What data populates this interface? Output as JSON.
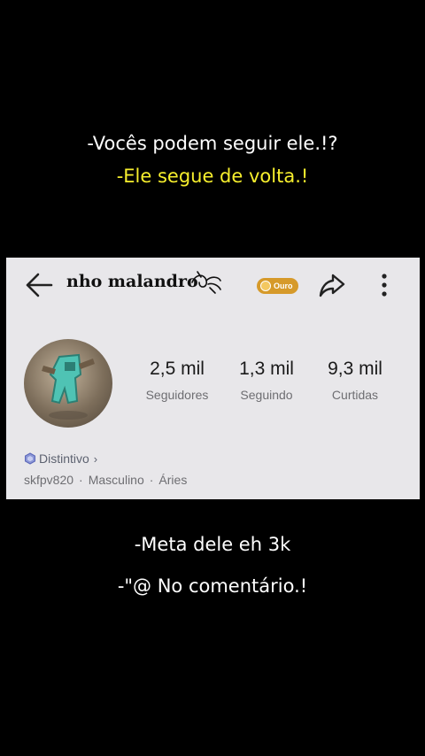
{
  "captions": {
    "line1": "-Vocês podem seguir ele.!?",
    "line2": "-Ele segue de volta.!",
    "line3": "-Meta dele eh 3k",
    "line4": "-\"@ No comentário.!"
  },
  "colors": {
    "background": "#000000",
    "caption_white": "#ffffff",
    "caption_yellow": "#f7ef2d",
    "card": "#e8e7ea",
    "rank_badge": "#d69a2a"
  },
  "profile": {
    "name": "nho malandro",
    "rank_label": "Ouro",
    "stats": [
      {
        "value": "2,5 mil",
        "label": "Seguidores"
      },
      {
        "value": "1,3 mil",
        "label": "Seguindo"
      },
      {
        "value": "9,3 mil",
        "label": "Curtidas"
      }
    ],
    "badge_label": "Distintivo",
    "username": "skfpv820",
    "gender": "Masculino",
    "sign": "Áries",
    "separator": "·"
  },
  "icons": {
    "back": "arrow-left-icon",
    "share": "share-icon",
    "more": "more-vertical-icon",
    "badge": "hexagon-badge-icon",
    "chevron": "chevron-right-icon"
  }
}
